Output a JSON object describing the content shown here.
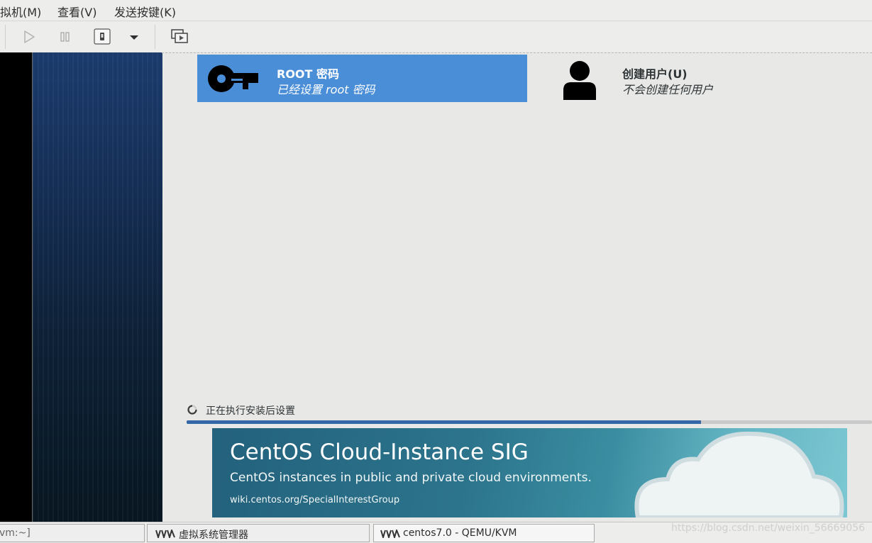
{
  "menubar": {
    "items": [
      {
        "label": "拟机(M)"
      },
      {
        "label": "查看(V)"
      },
      {
        "label": "发送按键(K)"
      }
    ]
  },
  "toolbar": {
    "icons": [
      "play-icon",
      "pause-icon",
      "shutdown-icon",
      "dropdown-arrow-icon",
      "screens-icon"
    ]
  },
  "installer": {
    "root": {
      "title": "ROOT 密码",
      "status": "已经设置 root 密码",
      "icon": "key-icon",
      "color": "#4a8ed8"
    },
    "user": {
      "title": "创建用户(U)",
      "status": "不会创建任何用户",
      "icon": "user-icon"
    },
    "progress": {
      "label": "正在执行安装后设置",
      "fraction": 0.75,
      "color": "#3466a8"
    },
    "banner": {
      "title": "CentOS Cloud-Instance SIG",
      "subtitle": "CentOS instances in public and private cloud environments.",
      "url": "wiki.centos.org/SpecialInterestGroup"
    }
  },
  "taskbar": {
    "terminal_label": "vm:~]",
    "items": [
      {
        "label": "虚拟系统管理器"
      },
      {
        "label": "centos7.0 - QEMU/KVM"
      }
    ],
    "watermark": "https://blog.csdn.net/weixin_56669056"
  }
}
